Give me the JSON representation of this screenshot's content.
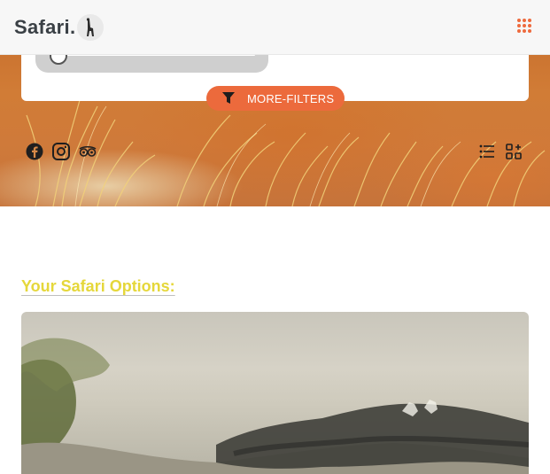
{
  "brand": {
    "name": "Safari.",
    "logo_icon": "giraffe-icon"
  },
  "nav": {
    "menu_icon": "grid-menu-icon"
  },
  "filters": {
    "more_filters_label": "MORE-FILTERS",
    "more_filters_icon": "funnel-icon",
    "slider_value": 0
  },
  "socials": [
    {
      "name": "facebook-icon"
    },
    {
      "name": "instagram-icon"
    },
    {
      "name": "tripadvisor-icon"
    }
  ],
  "view_toggles": [
    {
      "name": "list-view-icon"
    },
    {
      "name": "grid-add-view-icon"
    }
  ],
  "section": {
    "title": "Your Safari Options:"
  },
  "colors": {
    "accent": "#ec6a3c",
    "title": "#e5d73a",
    "logo_text": "#3a4045"
  }
}
